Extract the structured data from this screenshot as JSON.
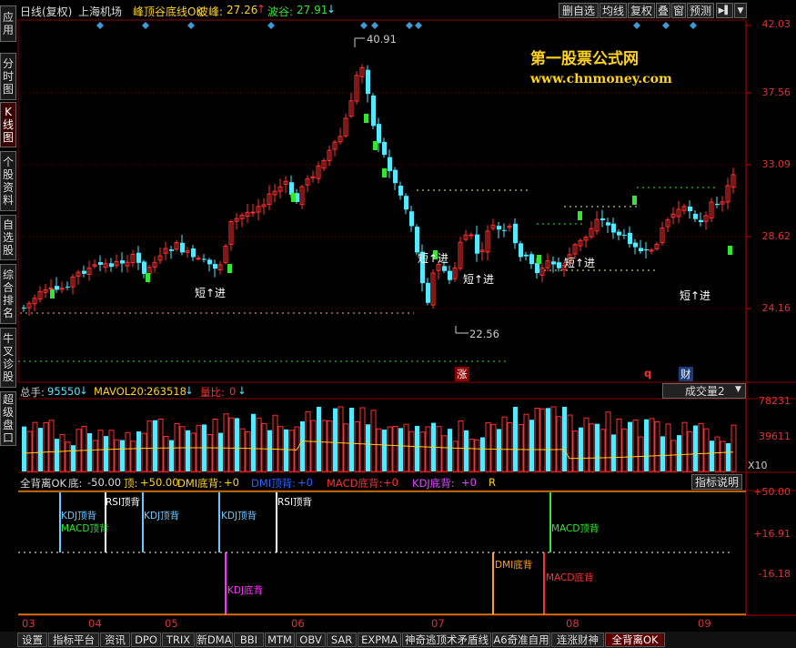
{
  "sidebar": [
    {
      "label": "应用"
    },
    {
      "label": "分时图"
    },
    {
      "label": "K线图"
    },
    {
      "label": "个股资料"
    },
    {
      "label": "自选股"
    },
    {
      "label": "综合排名"
    },
    {
      "label": "牛叉诊股"
    },
    {
      "label": "超级盘口"
    }
  ],
  "header": {
    "period": "日线(复权)",
    "stock": "上海机场",
    "indicator": "峰顶谷底线OK",
    "peak_label": "波峰:",
    "peak_value": "27.26",
    "peak_arrow": "↑",
    "valley_label": "波谷:",
    "valley_value": "27.91",
    "valley_arrow": "↓"
  },
  "toolbar": {
    "b1": "删自选",
    "b2": "均线",
    "b3": "复权",
    "b4": "叠",
    "b5": "窗",
    "b6": "预测",
    "pin": "▶▌",
    "menu": "▼"
  },
  "watermark": {
    "line1": "第一股票公式网",
    "line2": "www.chnmoney.com"
  },
  "price_axis": [
    "42.03",
    "37.56",
    "33.09",
    "28.62",
    "24.16"
  ],
  "annotations": {
    "high": "40.91",
    "low": "22.56",
    "signal": "短↑进",
    "rise": "涨",
    "q": "q",
    "cai": "财"
  },
  "volume": {
    "zongshou_label": "总手:",
    "zongshou": "95550",
    "mavol_label": "MAVOL20:",
    "mavol": "263518",
    "liangbi_label": "量比:",
    "liangbi": "0",
    "dropdown": "成交量2",
    "axis": [
      "78231",
      "39611"
    ],
    "unit": "X10"
  },
  "divergence": {
    "title": "全背离OK",
    "di_label": "底:",
    "di": "-50.00",
    "ding_label": "顶:",
    "ding": "+50.00",
    "dmi": "DMI底背:",
    "dmi_v": "+0",
    "dmi2": "DMI顶背:",
    "dmi2_v": "+0",
    "macd": "MACD底背:",
    "macd_v": "+0",
    "kdj": "KDJ底背:",
    "kdj_v": "+0",
    "r": "R",
    "button": "指标说明",
    "axis": [
      "+50.00",
      "+16.91",
      "-16.18"
    ],
    "labels": {
      "kdj_top": "KDJ顶背",
      "macd_top": "MACD顶背",
      "rsi_top": "RSI顶背",
      "kdj_bottom": "KDJ底背",
      "dmi_bottom": "DMI底背",
      "macd_bottom": "MACD底背"
    }
  },
  "date_axis": [
    "03",
    "04",
    "05",
    "06",
    "07",
    "08",
    "09"
  ],
  "tabs": [
    "设置",
    "指标平台",
    "资讯",
    "DPO",
    "TRIX",
    "新DMA",
    "BBI",
    "MTM",
    "OBV",
    "SAR",
    "EXPMA",
    "神奇逃顶术矛盾线",
    "A6奇准自用",
    "连涨财神",
    "全背离OK"
  ],
  "tab_active": "全背离OK",
  "colors": {
    "up": "#ff3030",
    "down": "#55e8ff",
    "axis": "#c00000",
    "grid": "#8b0000",
    "yellow": "#ffd21e"
  }
}
